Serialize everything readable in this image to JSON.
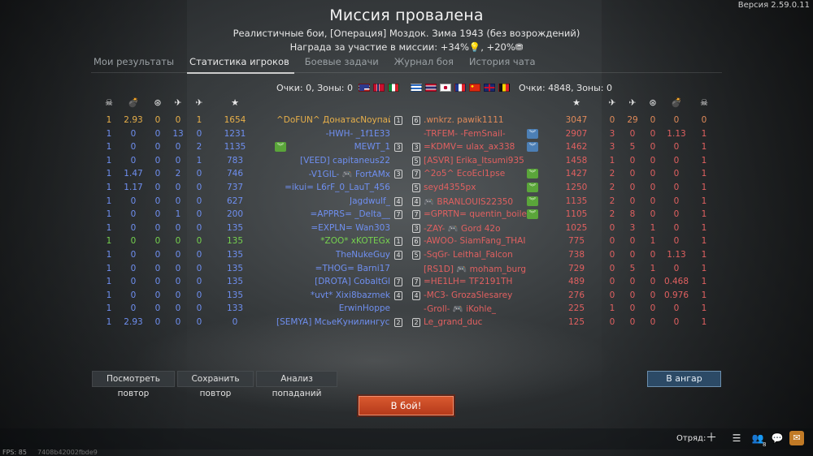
{
  "version": "Версия 2.59.0.11",
  "title": "Миссия провалена",
  "subtitle": "Реалистичные бои, [Операция] Моздок. Зима 1943 (без возрождений)",
  "reward": "Награда за участие в миссии: +34%💡, +20%⛃",
  "tabs": [
    "Мои результаты",
    "Статистика игроков",
    "Боевые задачи",
    "Журнал боя",
    "История чата"
  ],
  "active_tab": 1,
  "score_left": "Очки: 0, Зоны: 0",
  "score_right": "Очки: 4848, Зоны: 0",
  "flags_left": [
    "usa",
    "norway",
    "italy"
  ],
  "flags_right": [
    "greece",
    "thailand",
    "japan",
    "france",
    "china",
    "uk",
    "belgium"
  ],
  "colors": {
    "ally": "#6f8ff0",
    "enemy": "#e06060",
    "me": "#e8b04a",
    "squad": "#76d24f",
    "enemy_alt": "#e08a5a"
  },
  "column_icons_left": [
    "skull-icon",
    "bomb-icon",
    "ground-target-icon",
    "air-kill-icon",
    "plane-icon",
    "star-icon"
  ],
  "column_icons_right": [
    "star-icon",
    "plane-icon",
    "air-kill-icon",
    "ground-target-icon",
    "bomb-icon",
    "skull-icon"
  ],
  "allies": [
    {
      "stats": [
        "1",
        "2.93",
        "0",
        "0",
        "1",
        "1654"
      ],
      "name": "^DoFUN^ ДонатасNoупай...",
      "lvl": "1",
      "chev": "",
      "kind": "me"
    },
    {
      "stats": [
        "1",
        "0",
        "0",
        "13",
        "0",
        "1231"
      ],
      "name": "-HWH- _1f1E33",
      "lvl": "",
      "chev": "",
      "kind": "ally"
    },
    {
      "stats": [
        "1",
        "0",
        "0",
        "0",
        "2",
        "1135"
      ],
      "name": "MEWT_1",
      "lvl": "3",
      "chev": "green",
      "kind": "ally"
    },
    {
      "stats": [
        "1",
        "0",
        "0",
        "0",
        "1",
        "783"
      ],
      "name": "[VEED] capitaneus22",
      "lvl": "",
      "chev": "",
      "kind": "ally"
    },
    {
      "stats": [
        "1",
        "1.47",
        "0",
        "2",
        "0",
        "746"
      ],
      "name": "-V1GIL- 🎮 FortAMx",
      "lvl": "3",
      "chev": "",
      "kind": "ally"
    },
    {
      "stats": [
        "1",
        "1.17",
        "0",
        "0",
        "0",
        "737"
      ],
      "name": "=ikui= L6rF_0_LauT_456",
      "lvl": "",
      "chev": "",
      "kind": "ally"
    },
    {
      "stats": [
        "1",
        "0",
        "0",
        "0",
        "0",
        "627"
      ],
      "name": "Jagdwulf_",
      "lvl": "4",
      "chev": "",
      "kind": "ally"
    },
    {
      "stats": [
        "1",
        "0",
        "0",
        "1",
        "0",
        "200"
      ],
      "name": "=APPRS= _Delta__",
      "lvl": "7",
      "chev": "",
      "kind": "ally"
    },
    {
      "stats": [
        "1",
        "0",
        "0",
        "0",
        "0",
        "135"
      ],
      "name": "=EXPLN= Wan303",
      "lvl": "",
      "chev": "",
      "kind": "ally"
    },
    {
      "stats": [
        "1",
        "0",
        "0",
        "0",
        "0",
        "135"
      ],
      "name": "*ZOO* xKOTEGx",
      "lvl": "1",
      "chev": "",
      "kind": "squad"
    },
    {
      "stats": [
        "1",
        "0",
        "0",
        "0",
        "0",
        "135"
      ],
      "name": "TheNukeGuy",
      "lvl": "4",
      "chev": "",
      "kind": "ally"
    },
    {
      "stats": [
        "1",
        "0",
        "0",
        "0",
        "0",
        "135"
      ],
      "name": "=THOG= Barni17",
      "lvl": "",
      "chev": "",
      "kind": "ally"
    },
    {
      "stats": [
        "1",
        "0",
        "0",
        "0",
        "0",
        "135"
      ],
      "name": "[DROTA] CobaltGl",
      "lvl": "7",
      "chev": "",
      "kind": "ally"
    },
    {
      "stats": [
        "1",
        "0",
        "0",
        "0",
        "0",
        "135"
      ],
      "name": "*uvt* Xixi8bazmek",
      "lvl": "4",
      "chev": "",
      "kind": "ally"
    },
    {
      "stats": [
        "1",
        "0",
        "0",
        "0",
        "0",
        "133"
      ],
      "name": "ErwinHoppe",
      "lvl": "",
      "chev": "",
      "kind": "ally"
    },
    {
      "stats": [
        "1",
        "2.93",
        "0",
        "0",
        "0",
        "0"
      ],
      "name": "[SEMYA] МсьеКунилингус...",
      "lvl": "2",
      "chev": "",
      "kind": "ally"
    }
  ],
  "enemies": [
    {
      "stats": [
        "3047",
        "0",
        "29",
        "0",
        "0",
        "0"
      ],
      "name": ".wnkrz. pawik1111",
      "lvl": "6",
      "chev": "",
      "kind": "enemy_alt"
    },
    {
      "stats": [
        "2907",
        "3",
        "0",
        "0",
        "1.13",
        "1"
      ],
      "name": "-TRFEM- -FemSnail-",
      "lvl": "",
      "chev": "blue",
      "kind": "enemy"
    },
    {
      "stats": [
        "1462",
        "3",
        "5",
        "0",
        "0",
        "1"
      ],
      "name": "=KDMV= ulax_ax338",
      "lvl": "3",
      "chev": "blue",
      "kind": "enemy"
    },
    {
      "stats": [
        "1458",
        "1",
        "0",
        "0",
        "0",
        "1"
      ],
      "name": "[ASVR] Erika_Itsumi935",
      "lvl": "5",
      "chev": "",
      "kind": "enemy"
    },
    {
      "stats": [
        "1427",
        "2",
        "0",
        "0",
        "0",
        "1"
      ],
      "name": "^2o5^ EcoEcl1pse",
      "lvl": "7",
      "chev": "green",
      "kind": "enemy"
    },
    {
      "stats": [
        "1250",
        "2",
        "0",
        "0",
        "0",
        "1"
      ],
      "name": "seyd4355px",
      "lvl": "5",
      "chev": "green",
      "kind": "enemy"
    },
    {
      "stats": [
        "1135",
        "2",
        "0",
        "0",
        "0",
        "1"
      ],
      "name": "🎮 BRANLOUIS22350",
      "lvl": "4",
      "chev": "green",
      "kind": "enemy"
    },
    {
      "stats": [
        "1105",
        "2",
        "8",
        "0",
        "0",
        "1"
      ],
      "name": "=GPRTN= quentin_boileau",
      "lvl": "7",
      "chev": "green",
      "kind": "enemy"
    },
    {
      "stats": [
        "1025",
        "0",
        "3",
        "1",
        "0",
        "1"
      ],
      "name": "-ZAY- 🎮 Gord 42o",
      "lvl": "3",
      "chev": "",
      "kind": "enemy"
    },
    {
      "stats": [
        "775",
        "0",
        "0",
        "1",
        "0",
        "1"
      ],
      "name": "-AWOO- SiamFang_THAI",
      "lvl": "6",
      "chev": "",
      "kind": "enemy"
    },
    {
      "stats": [
        "738",
        "0",
        "0",
        "0",
        "1.13",
        "1"
      ],
      "name": "-SqGr- Leithal_Falcon",
      "lvl": "5",
      "chev": "",
      "kind": "enemy"
    },
    {
      "stats": [
        "729",
        "0",
        "5",
        "1",
        "0",
        "1"
      ],
      "name": "[RS1D] 🎮 moham_burg",
      "lvl": "",
      "chev": "",
      "kind": "enemy"
    },
    {
      "stats": [
        "489",
        "0",
        "0",
        "0",
        "0.468",
        "1"
      ],
      "name": "=HE1LH= TF2191TH",
      "lvl": "7",
      "chev": "",
      "kind": "enemy"
    },
    {
      "stats": [
        "276",
        "0",
        "0",
        "0",
        "0.976",
        "1"
      ],
      "name": "-MC3- GrozaSlesarey",
      "lvl": "4",
      "chev": "",
      "kind": "enemy"
    },
    {
      "stats": [
        "225",
        "1",
        "0",
        "0",
        "0",
        "1"
      ],
      "name": "-Groll- 🎮 iKohle_",
      "lvl": "",
      "chev": "",
      "kind": "enemy"
    },
    {
      "stats": [
        "125",
        "0",
        "0",
        "0",
        "0",
        "1"
      ],
      "name": "Le_grand_duc",
      "lvl": "2",
      "chev": "",
      "kind": "enemy"
    }
  ],
  "buttons": {
    "replay": "Посмотреть повтор",
    "save_replay": "Сохранить повтор",
    "hit_analysis": "Анализ попаданий",
    "hangar": "В ангар",
    "battle": "В бой!"
  },
  "bottom": {
    "squad_label": "Отряд:",
    "friends_badge": "8",
    "fps": "FPS: 85",
    "hash": "7408b42002fbde9"
  }
}
